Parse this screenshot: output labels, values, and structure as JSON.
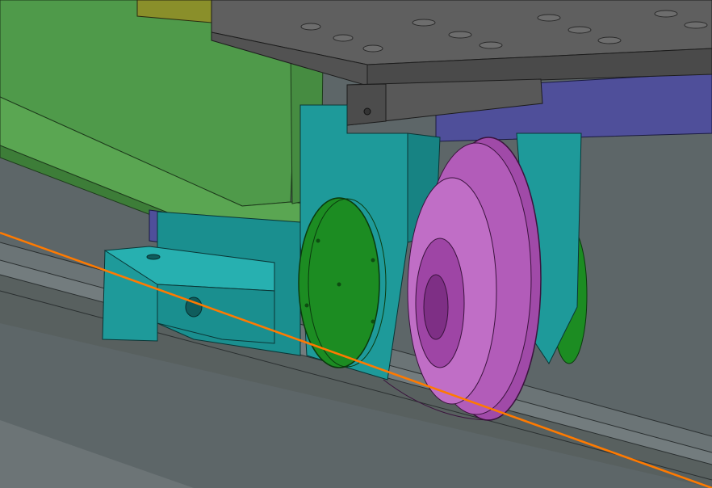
{
  "scene": {
    "kind": "cad-3d-viewport",
    "parts": [
      {
        "name": "steel-girder",
        "color": "#4f9a4a"
      },
      {
        "name": "top-deck-plate",
        "color": "#5f5f5f"
      },
      {
        "name": "yellow-rail-strip",
        "color": "#8a8f2a"
      },
      {
        "name": "blue-frame",
        "color": "#4f4f9a"
      },
      {
        "name": "cyan-wheel-bracket",
        "color": "#1e9a9a"
      },
      {
        "name": "green-flange-disc",
        "color": "#1c8c22"
      },
      {
        "name": "magenta-flanged-wheel",
        "color": "#a04aa8"
      },
      {
        "name": "ground-rail",
        "color": "#6a7274"
      },
      {
        "name": "orange-reference-line",
        "color": "#ff7a00"
      }
    ]
  }
}
